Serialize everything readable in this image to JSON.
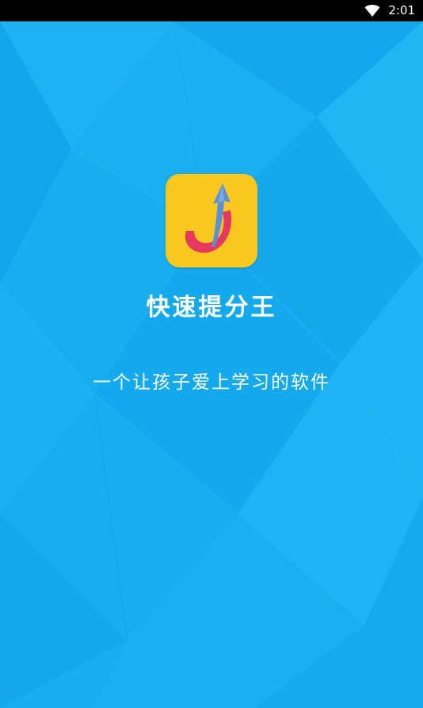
{
  "status_bar": {
    "time": "2:01",
    "icons": [
      "wifi-icon"
    ]
  },
  "splash": {
    "app_name": "快速提分王",
    "tagline": "一个让孩子爱上学习的软件",
    "logo_icon": "upward-arrow-j-logo"
  },
  "colors": {
    "background": "#17aef0",
    "logo_background": "#f8c81f",
    "logo_red": "#e6395f",
    "logo_blue": "#5b8fd6",
    "text": "#ffffff",
    "status_bar": "#000000"
  }
}
